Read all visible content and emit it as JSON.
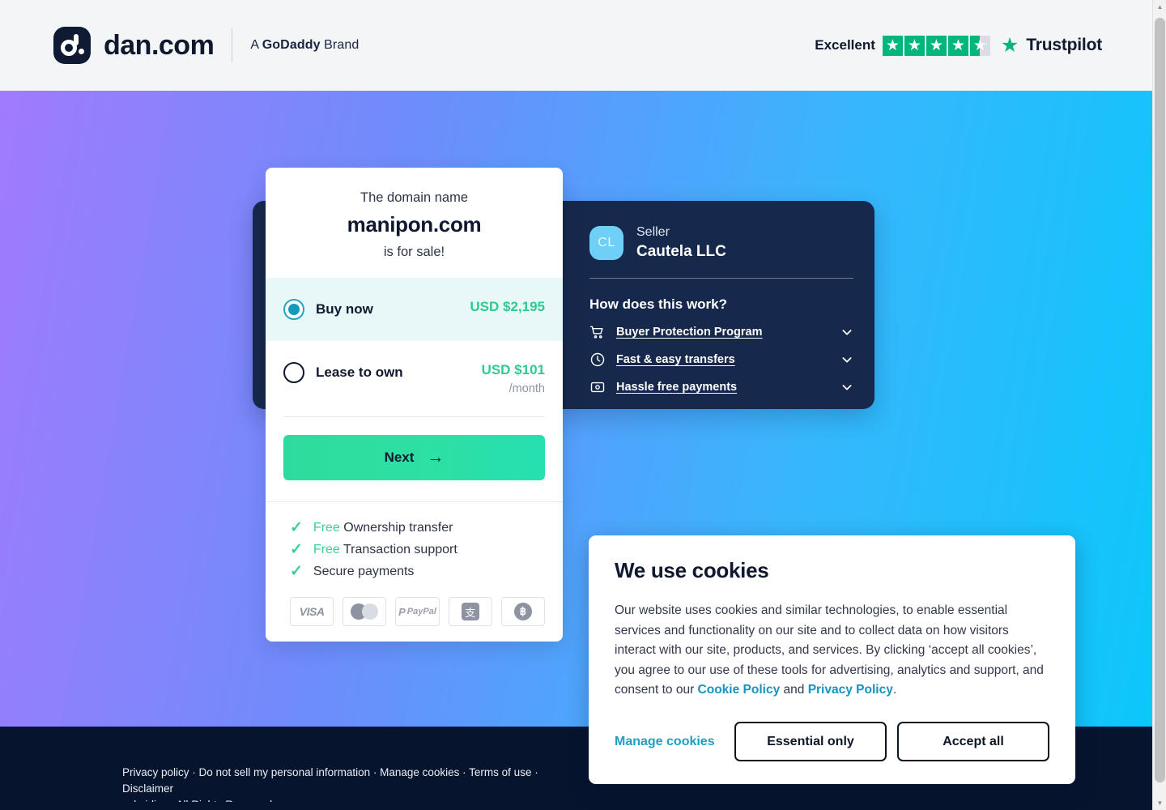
{
  "header": {
    "wordmark": "dan.com",
    "byline_prefix": "A ",
    "byline_brand": "GoDaddy",
    "byline_suffix": " Brand",
    "logo_icon": "dan-logo-icon",
    "trustpilot": {
      "rating_word": "Excellent",
      "name": "Trustpilot",
      "stars_filled": 4,
      "stars_half": 1,
      "star_color": "#00b67a"
    }
  },
  "offer": {
    "lead_text": "The domain name",
    "domain_name": "manipon.com",
    "tail_text": "is for sale!",
    "options": [
      {
        "label": "Buy now",
        "price": "USD $2,195",
        "sub": "",
        "selected": true
      },
      {
        "label": "Lease to own",
        "price": "USD $101",
        "sub": "/month",
        "selected": false
      }
    ],
    "next_label": "Next",
    "next_arrow": "→",
    "benefits": [
      {
        "highlight": "Free",
        "text": " Ownership transfer"
      },
      {
        "highlight": "Free",
        "text": " Transaction support"
      },
      {
        "highlight": "",
        "text": "Secure payments"
      }
    ],
    "payment_methods": [
      "visa",
      "mastercard",
      "paypal",
      "alipay",
      "bitcoin"
    ],
    "price_color": "#2ecb8e",
    "accent_color": "#2ddc9d"
  },
  "seller": {
    "avatar_initials": "CL",
    "label": "Seller",
    "name": "Cautela LLC",
    "how_title": "How does this work?",
    "items": [
      {
        "icon": "shopping-cart-icon",
        "label": "Buyer Protection Program"
      },
      {
        "icon": "clock-icon",
        "label": "Fast & easy transfers"
      },
      {
        "icon": "payment-card-icon",
        "label": "Hassle free payments"
      }
    ]
  },
  "cookie": {
    "title": "We use cookies",
    "body_part1": "Our website uses cookies and similar technologies, to enable essential services and functionality on our site and to collect data on how visitors interact with our site, products, and services. By clicking ‘accept all cookies’, you agree to our use of these tools for advertising, analytics and support, and consent to our ",
    "link_cookie_policy": "Cookie Policy",
    "body_part2": " and ",
    "link_privacy_policy": "Privacy Policy",
    "body_part3": ".",
    "manage_label": "Manage cookies",
    "essential_label": "Essential only",
    "accept_label": "Accept all"
  },
  "footer": {
    "text": "Privacy policy · Do not sell my personal information · Manage cookies · Terms of use · Disclaimer\nsubsidiary. All Rights Reserved."
  },
  "scrollbar": {
    "up_arrow": "▲",
    "down_arrow": "▼"
  }
}
